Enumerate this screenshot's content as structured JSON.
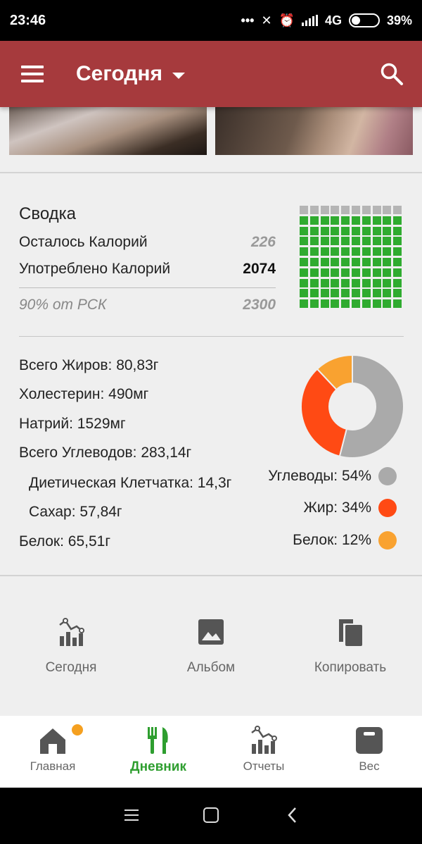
{
  "status_bar": {
    "time": "23:46",
    "network": "4G",
    "battery": "39%"
  },
  "app_bar": {
    "title": "Сегодня",
    "menu_icon": "hamburger-icon",
    "search_icon": "search-icon"
  },
  "summary": {
    "title": "Сводка",
    "remaining_label": "Осталось Калорий",
    "remaining_value": "226",
    "consumed_label": "Употреблено Калорий",
    "consumed_value": "2074",
    "rsk_label": "90% от РСК",
    "rsk_value": "2300",
    "grid": {
      "total_cells": 100,
      "filled_cells": 90,
      "filled_color": "#2fab2f",
      "empty_color": "#b5b5b5"
    }
  },
  "nutrients": [
    {
      "label": "Всего Жиров: 80,83г"
    },
    {
      "label": "Холестерин: 490мг"
    },
    {
      "label": "Натрий: 1529мг"
    },
    {
      "label": "Всего Углеводов: 283,14г"
    },
    {
      "label": "Диетическая Клетчатка: 14,3г"
    },
    {
      "label": "Сахар: 57,84г"
    },
    {
      "label": "Белок: 65,51г"
    }
  ],
  "macros": [
    {
      "label": "Углеводы: 54%",
      "percent": 54,
      "color": "#aaaaaa"
    },
    {
      "label": "Жир: 34%",
      "percent": 34,
      "color": "#ff4a14"
    },
    {
      "label": "Белок: 12%",
      "percent": 12,
      "color": "#f9a230"
    }
  ],
  "actions": [
    {
      "label": "Сегодня",
      "icon": "report-chart-icon"
    },
    {
      "label": "Альбом",
      "icon": "image-icon"
    },
    {
      "label": "Копировать",
      "icon": "copy-icon"
    }
  ],
  "bottom_nav": [
    {
      "label": "Главная",
      "icon": "home-icon",
      "active": false,
      "badge": true
    },
    {
      "label": "Дневник",
      "icon": "fork-knife-icon",
      "active": true
    },
    {
      "label": "Отчеты",
      "icon": "report-chart-icon",
      "active": false
    },
    {
      "label": "Вес",
      "icon": "scale-icon",
      "active": false
    }
  ],
  "colors": {
    "app_bar": "#a63a3d",
    "active_nav": "#2e9e2f"
  }
}
